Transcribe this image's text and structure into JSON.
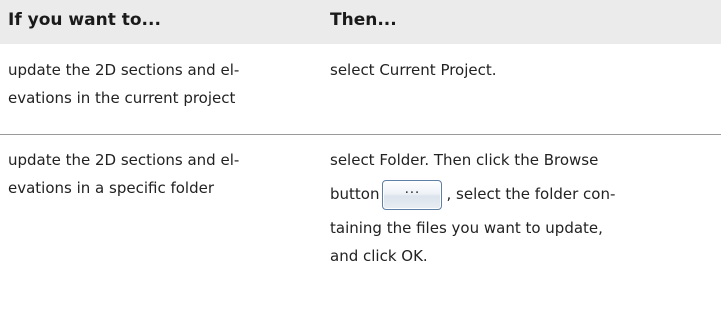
{
  "table": {
    "headers": {
      "col1": "If you want to...",
      "col2": "Then..."
    },
    "rows": [
      {
        "col1_lines": [
          "update the 2D sections and el-",
          "evations in the current project"
        ],
        "col2_lines": [
          "select Current Project."
        ]
      },
      {
        "col1_lines": [
          "update the 2D sections and el-",
          "evations in a specific folder"
        ],
        "col2_lines": [
          "select Folder. Then click the Browse",
          "button",
          ", select the folder con-",
          "taining the files you want to update,",
          "and click OK."
        ],
        "browse_button_glyph": "..."
      }
    ]
  },
  "icons": {
    "browse": "browse-button-icon"
  }
}
